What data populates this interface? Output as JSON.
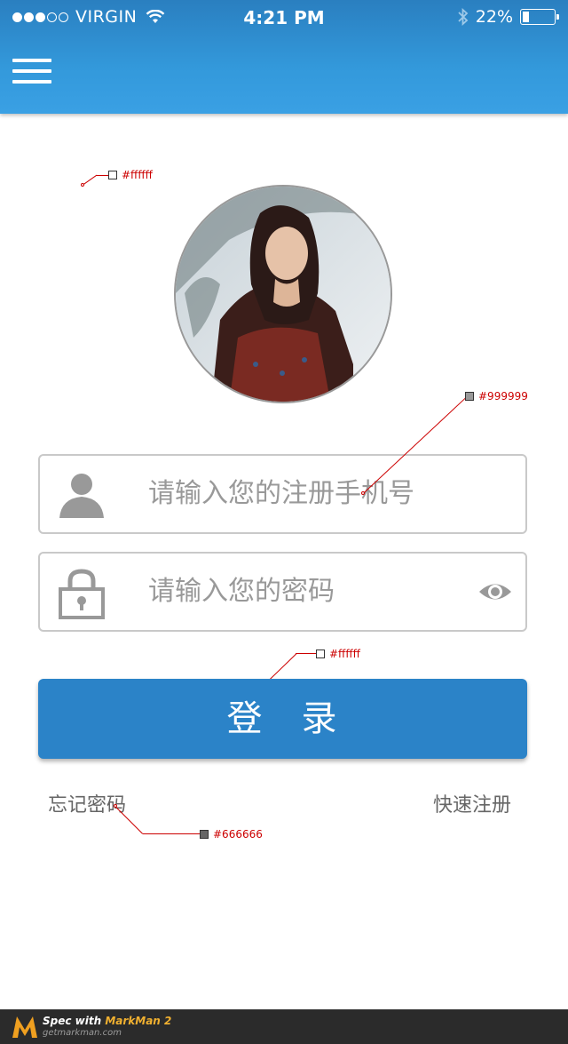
{
  "statusbar": {
    "signal_dots_filled": 3,
    "signal_dots_total": 5,
    "carrier": "VIRGIN",
    "time": "4:21 PM",
    "battery": "22%",
    "battery_level": 0.22
  },
  "header": {
    "menu_icon": "hamburger-menu-icon"
  },
  "login": {
    "phone_placeholder": "请输入您的注册手机号",
    "password_placeholder": "请输入您的密码",
    "submit_label": "登　录",
    "forgot_password": "忘记密码",
    "quick_register": "快速注册"
  },
  "specs": {
    "avatar_bg": "#ffffff",
    "placeholder_color": "#999999",
    "button_text": "#ffffff",
    "link_color": "#666666"
  },
  "footer": {
    "spec_prefix": "Spec with",
    "spec_brand": "MarkMan 2",
    "url": "getmarkman.com"
  },
  "colors": {
    "header": "#3399db",
    "button": "#2b83c8",
    "field_border": "#c9c9c9",
    "icon_gray": "#999999"
  }
}
